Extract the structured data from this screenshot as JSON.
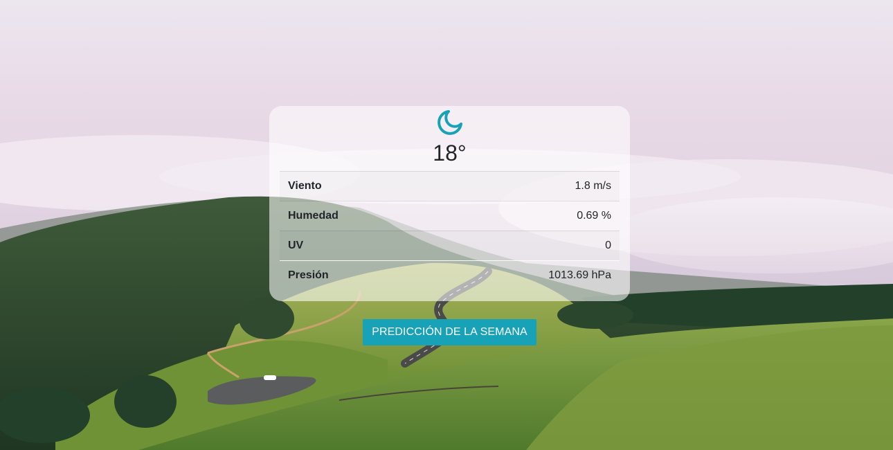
{
  "weather": {
    "icon": "moon-crescent-icon",
    "temperature": "18°",
    "rows": [
      {
        "label": "Viento",
        "value": "1.8 m/s"
      },
      {
        "label": "Humedad",
        "value": "0.69 %"
      },
      {
        "label": "UV",
        "value": "0"
      },
      {
        "label": "Presión",
        "value": "1013.69 hPa"
      }
    ]
  },
  "actions": {
    "week_forecast_label": "PREDICCIÓN DE LA SEMANA"
  },
  "colors": {
    "accent": "#17a2b8",
    "text": "#212529"
  }
}
